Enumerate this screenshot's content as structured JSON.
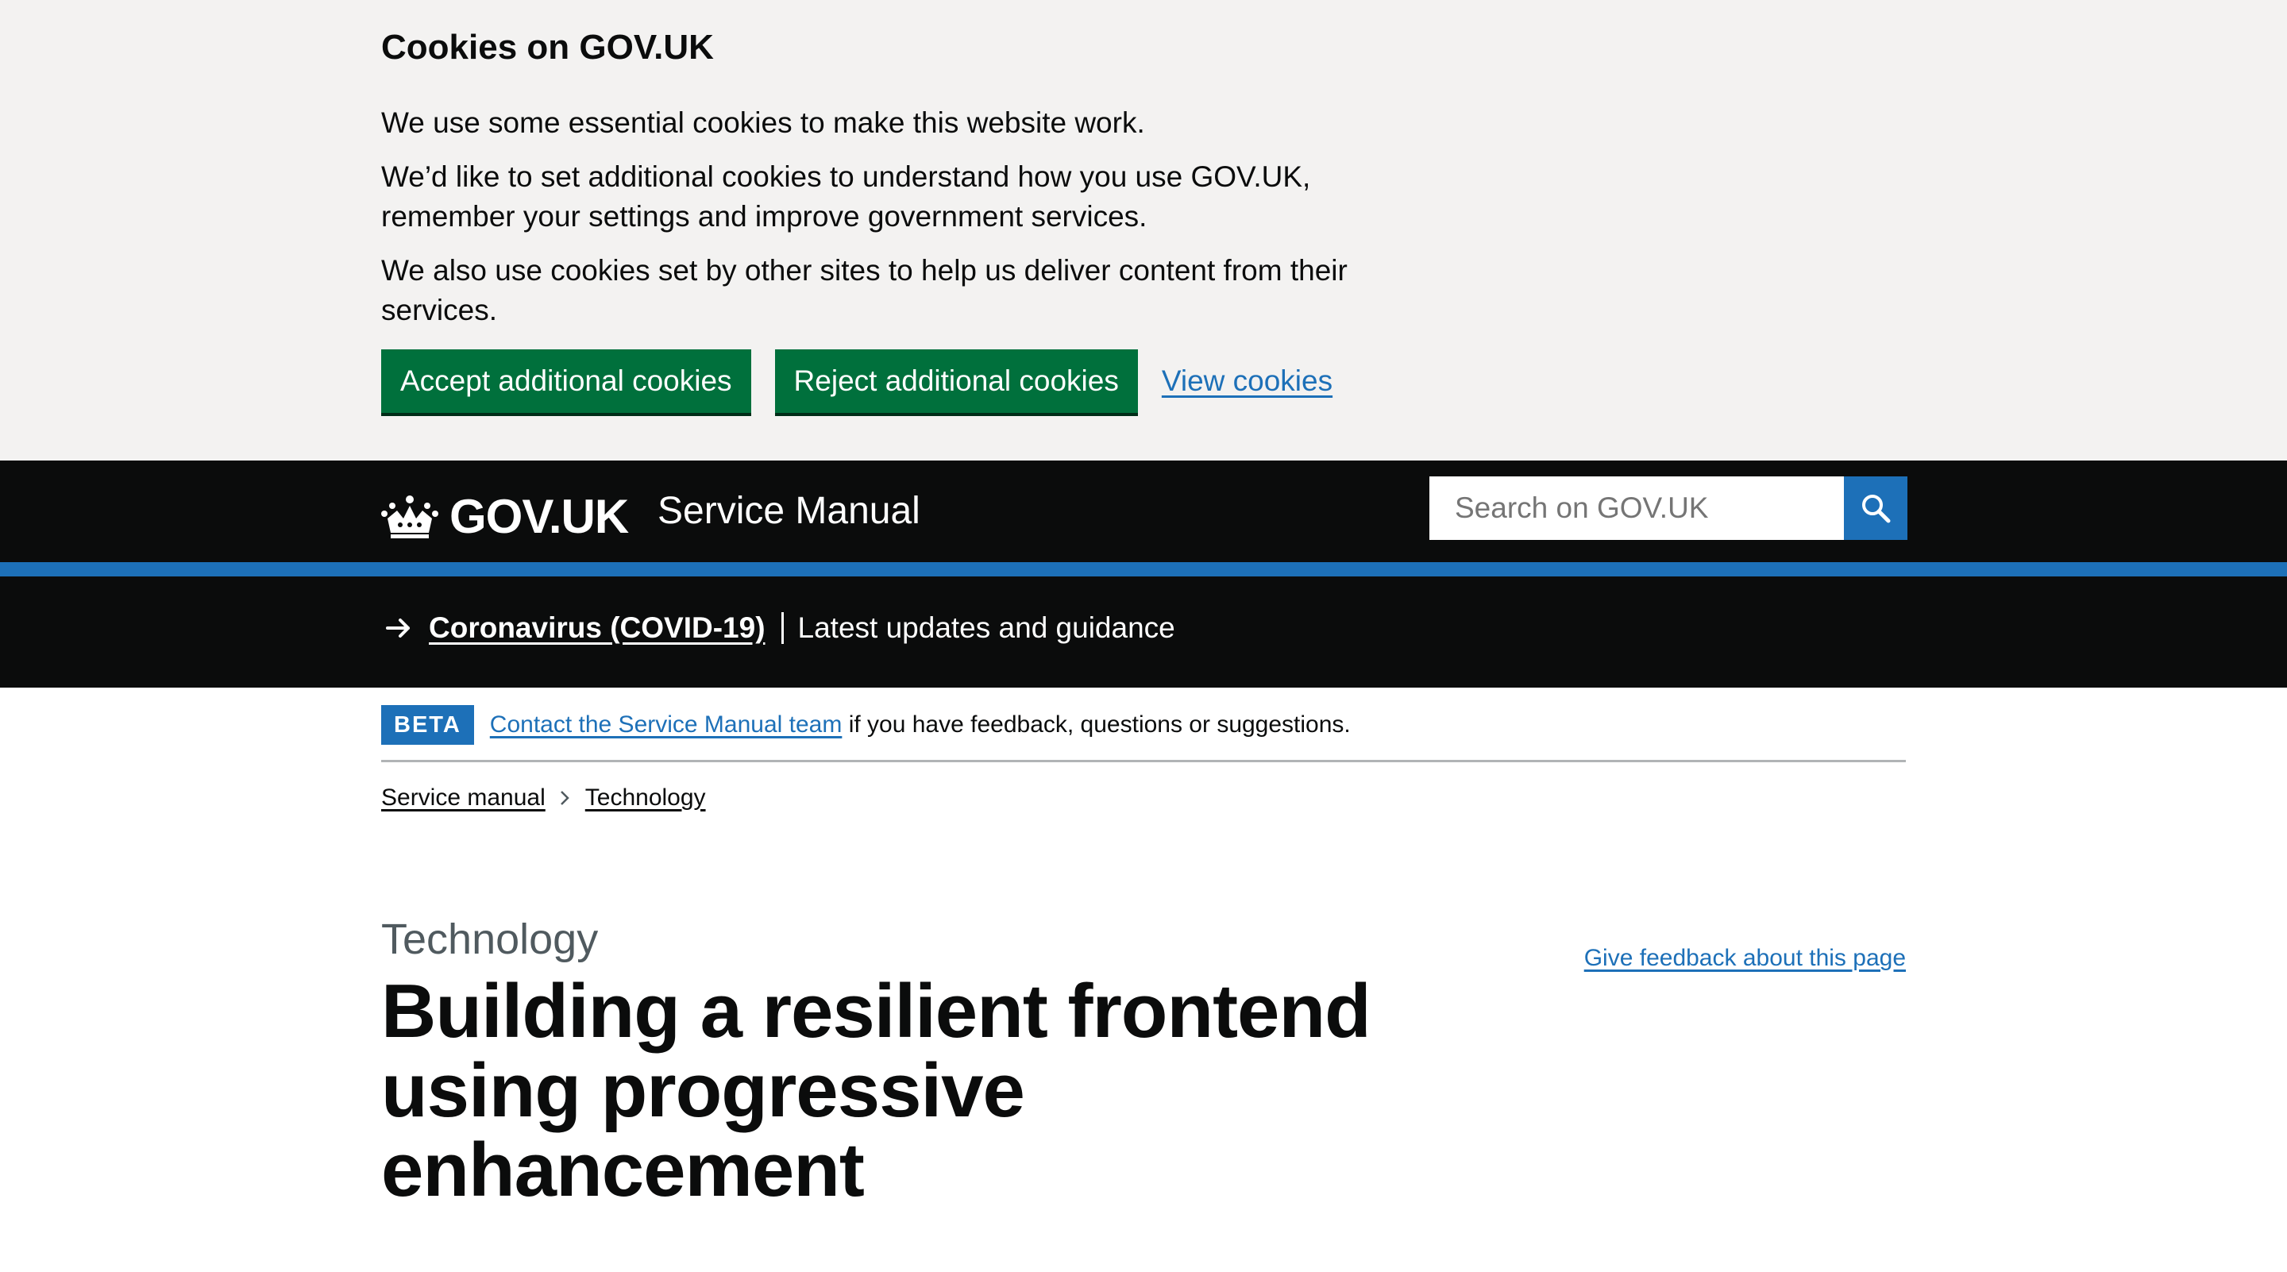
{
  "cookie_banner": {
    "title": "Cookies on GOV.UK",
    "paragraphs": [
      "We use some essential cookies to make this website work.",
      "We’d like to set additional cookies to understand how you use GOV.UK, remember your settings and improve government services.",
      "We also use cookies set by other sites to help us deliver content from their services."
    ],
    "accept_label": "Accept additional cookies",
    "reject_label": "Reject additional cookies",
    "view_label": "View cookies"
  },
  "header": {
    "logo_text": "GOV.UK",
    "service_name": "Service Manual",
    "search_placeholder": "Search on GOV.UK",
    "search_icon": "search-icon",
    "crown_icon": "crown-icon"
  },
  "emergency_banner": {
    "link_text": "Coronavirus (COVID-19)",
    "text": "Latest updates and guidance",
    "icon": "arrow-right-icon"
  },
  "phase_banner": {
    "tag": "BETA",
    "link_text": "Contact the Service Manual team",
    "text": " if you have feedback, questions or suggestions."
  },
  "breadcrumb": {
    "items": [
      "Service manual",
      "Technology"
    ]
  },
  "main": {
    "caption": "Technology",
    "title": "Building a resilient frontend using progressive enhancement",
    "feedback_link": "Give feedback about this page"
  },
  "colors": {
    "brand_black": "#0b0c0c",
    "brand_blue": "#1d70b8",
    "button_green": "#00703c",
    "banner_grey": "#f3f2f1"
  }
}
